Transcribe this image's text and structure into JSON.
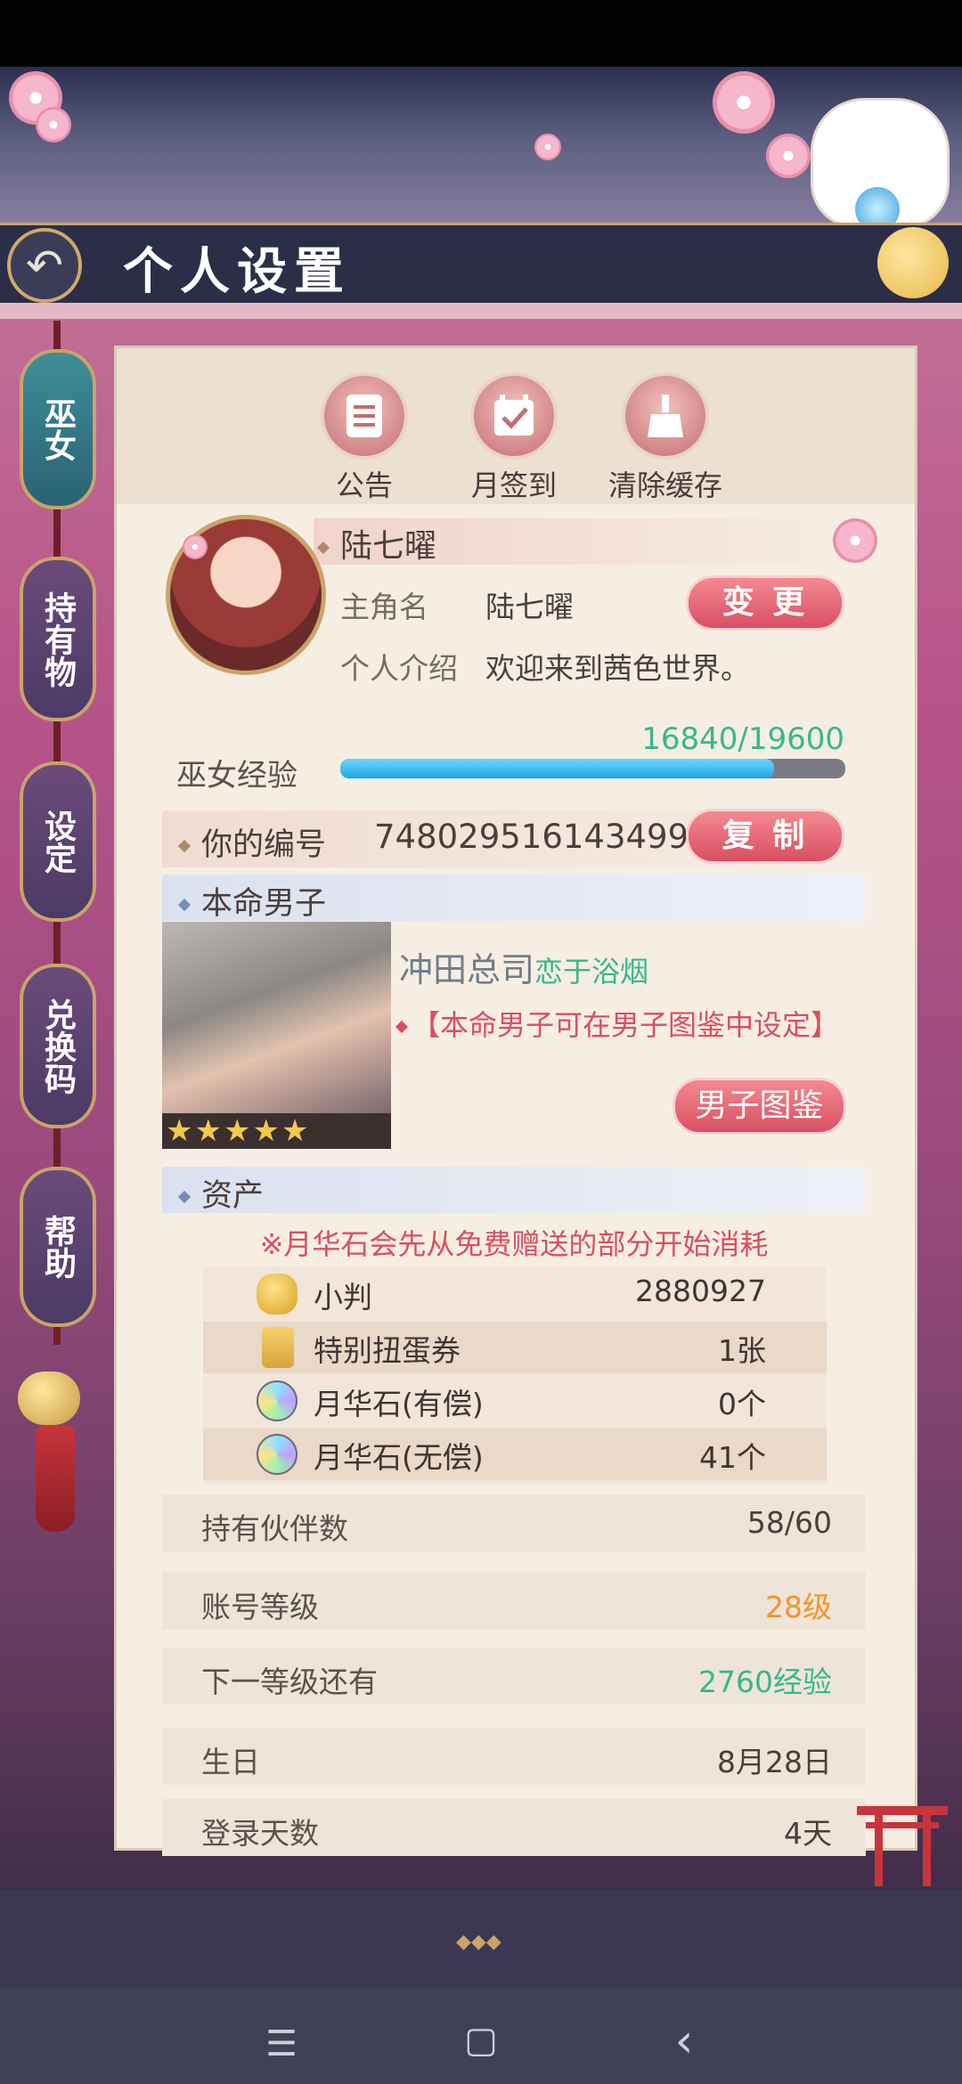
{
  "header": {
    "title": "个人设置"
  },
  "side_tabs": [
    {
      "label": "巫女",
      "active": true
    },
    {
      "label": "持有物",
      "active": false
    },
    {
      "label": "设定",
      "active": false
    },
    {
      "label": "兑换码",
      "active": false
    },
    {
      "label": "帮助",
      "active": false
    }
  ],
  "toolbar": [
    {
      "label": "公告",
      "icon": "notice-icon"
    },
    {
      "label": "月签到",
      "icon": "calendar-check-icon"
    },
    {
      "label": "清除缓存",
      "icon": "broom-icon"
    }
  ],
  "profile": {
    "display_name": "陆七曜",
    "protagonist_label": "主角名",
    "protagonist_value": "陆七曜",
    "change_button": "变 更",
    "intro_label": "个人介绍",
    "intro_value": "欢迎来到茜色世界。",
    "exp_label": "巫女经验",
    "exp_text": "16840/19600",
    "exp_fraction": 0.859
  },
  "id_row": {
    "label": "你的编号",
    "value": "748029516143499",
    "copy_button": "复 制"
  },
  "partner": {
    "section_title": "本命男子",
    "name": "冲田总司",
    "subtitle": "恋于浴烟",
    "note": "【本命男子可在男子图鉴中设定】",
    "button": "男子图鉴",
    "stars": "★★★★★"
  },
  "assets": {
    "section_title": "资产",
    "notice": "※月华石会先从免费赠送的部分开始消耗",
    "items": [
      {
        "name": "小判",
        "value": "2880927",
        "icon": "gold-coin-icon"
      },
      {
        "name": "特别扭蛋券",
        "value": "1张",
        "icon": "gacha-ticket-icon"
      },
      {
        "name": "月华石(有偿)",
        "value": "0个",
        "icon": "moonstone-icon"
      },
      {
        "name": "月华石(无偿)",
        "value": "41个",
        "icon": "moonstone-icon"
      }
    ]
  },
  "stats": [
    {
      "label": "持有伙伴数",
      "value": "58/60",
      "color": "#4a3f3a"
    },
    {
      "label": "账号等级",
      "value": "28级",
      "color": "#f0962a"
    },
    {
      "label": "下一等级还有",
      "value": "2760经验",
      "color": "#35b98c"
    },
    {
      "label": "生日",
      "value": "8月28日",
      "color": "#4a3f3a"
    },
    {
      "label": "登录天数",
      "value": "4天",
      "color": "#4a3f3a"
    }
  ],
  "colors": {
    "accent_pink": "#d94f62",
    "teal": "#35b98c",
    "orange": "#f0962a",
    "exp_blue": "#1ea6e6"
  },
  "nav": {
    "menu": "☰",
    "home": "▢",
    "back": "‹"
  }
}
